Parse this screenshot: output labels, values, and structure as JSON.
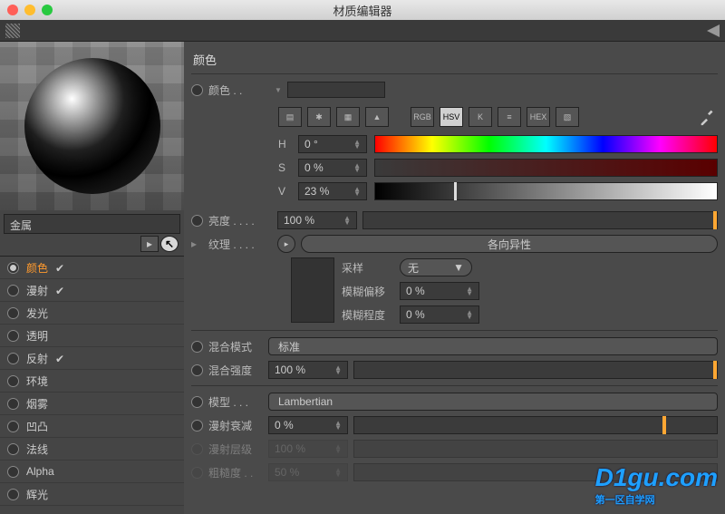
{
  "titlebar": {
    "title": "材质编辑器"
  },
  "material": {
    "name": "金属"
  },
  "channels": [
    {
      "key": "color",
      "label": "颜色",
      "checked": true,
      "selected": true
    },
    {
      "key": "diffuse",
      "label": "漫射",
      "checked": true,
      "selected": false
    },
    {
      "key": "lumin",
      "label": "发光",
      "checked": false,
      "selected": false
    },
    {
      "key": "transp",
      "label": "透明",
      "checked": false,
      "selected": false
    },
    {
      "key": "reflect",
      "label": "反射",
      "checked": true,
      "selected": false
    },
    {
      "key": "env",
      "label": "环境",
      "checked": false,
      "selected": false
    },
    {
      "key": "fog",
      "label": "烟雾",
      "checked": false,
      "selected": false
    },
    {
      "key": "bump",
      "label": "凹凸",
      "checked": false,
      "selected": false
    },
    {
      "key": "normal",
      "label": "法线",
      "checked": false,
      "selected": false
    },
    {
      "key": "alpha",
      "label": "Alpha",
      "checked": false,
      "selected": false
    },
    {
      "key": "glow",
      "label": "辉光",
      "checked": false,
      "selected": false
    }
  ],
  "section": {
    "title": "颜色"
  },
  "color_row": {
    "label": "颜色 . ."
  },
  "color_modes": {
    "rgb": "RGB",
    "hsv": "HSV",
    "k": "K",
    "hex": "HEX"
  },
  "hsv": {
    "h_label": "H",
    "h": "0 °",
    "s_label": "S",
    "s": "0 %",
    "v_label": "V",
    "v": "23 %"
  },
  "brightness": {
    "label": "亮度 . . . .",
    "value": "100 %"
  },
  "texture": {
    "label": "纹理 . . . .",
    "aniso": "各向异性"
  },
  "sampling": {
    "sample_label": "采样",
    "sample_value": "无",
    "bluroff_label": "模糊偏移",
    "bluroff_value": "0 %",
    "blurscale_label": "模糊程度",
    "blurscale_value": "0 %"
  },
  "mix": {
    "mode_label": "混合模式",
    "mode_value": "标准",
    "strength_label": "混合强度",
    "strength_value": "100 %"
  },
  "model": {
    "label": "模型 . . .",
    "value": "Lambertian"
  },
  "falloff": {
    "label": "漫射衰减",
    "value": "0 %"
  },
  "levels": {
    "label": "漫射层级",
    "value": "100 %"
  },
  "rough": {
    "label": "粗糙度 . .",
    "value": "50 %"
  },
  "watermark": {
    "main": "D1gu.com",
    "sub": "第一区自学网"
  }
}
